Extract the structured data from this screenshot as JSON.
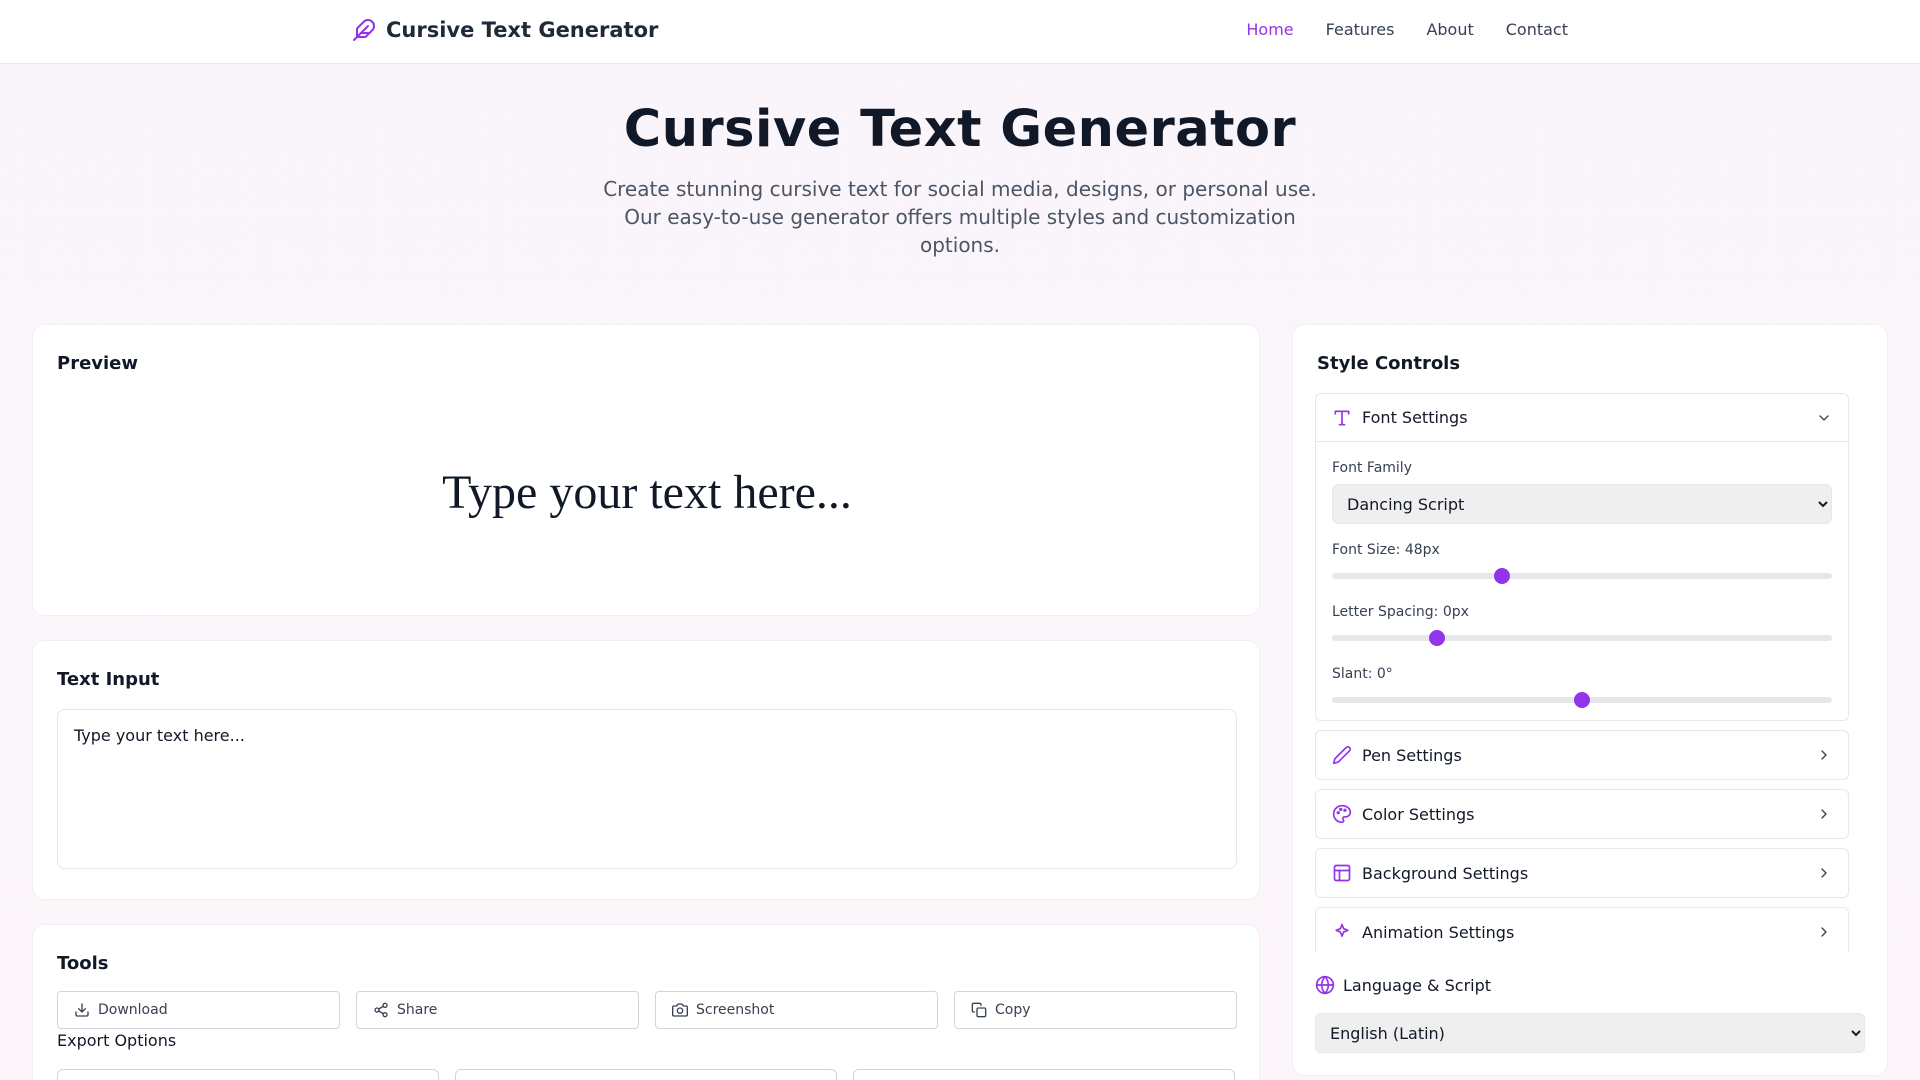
{
  "header": {
    "brand": "Cursive Text Generator",
    "nav": [
      {
        "label": "Home",
        "active": true
      },
      {
        "label": "Features",
        "active": false
      },
      {
        "label": "About",
        "active": false
      },
      {
        "label": "Contact",
        "active": false
      }
    ]
  },
  "hero": {
    "title": "Cursive Text Generator",
    "subtitle": "Create stunning cursive text for social media, designs, or personal use. Our easy-to-use generator offers multiple styles and customization options."
  },
  "preview": {
    "title": "Preview",
    "text": "Type your text here..."
  },
  "text_input": {
    "title": "Text Input",
    "value": "Type your text here..."
  },
  "tools": {
    "title": "Tools",
    "buttons": [
      "Download",
      "Share",
      "Screenshot",
      "Copy"
    ],
    "export_label": "Export Options"
  },
  "controls": {
    "title": "Style Controls",
    "font_settings": {
      "label": "Font Settings",
      "font_family_label": "Font Family",
      "font_family_value": "Dancing Script",
      "font_size_label": "Font Size: 48px",
      "font_size_fraction": 0.34,
      "letter_spacing_label": "Letter Spacing: 0px",
      "letter_spacing_fraction": 0.21,
      "slant_label": "Slant: 0°",
      "slant_fraction": 0.5
    },
    "sections": [
      "Pen Settings",
      "Color Settings",
      "Background Settings",
      "Animation Settings"
    ],
    "language_label": "Language & Script",
    "language_value": "English (Latin)"
  },
  "colors": {
    "accent": "#9333ea"
  }
}
